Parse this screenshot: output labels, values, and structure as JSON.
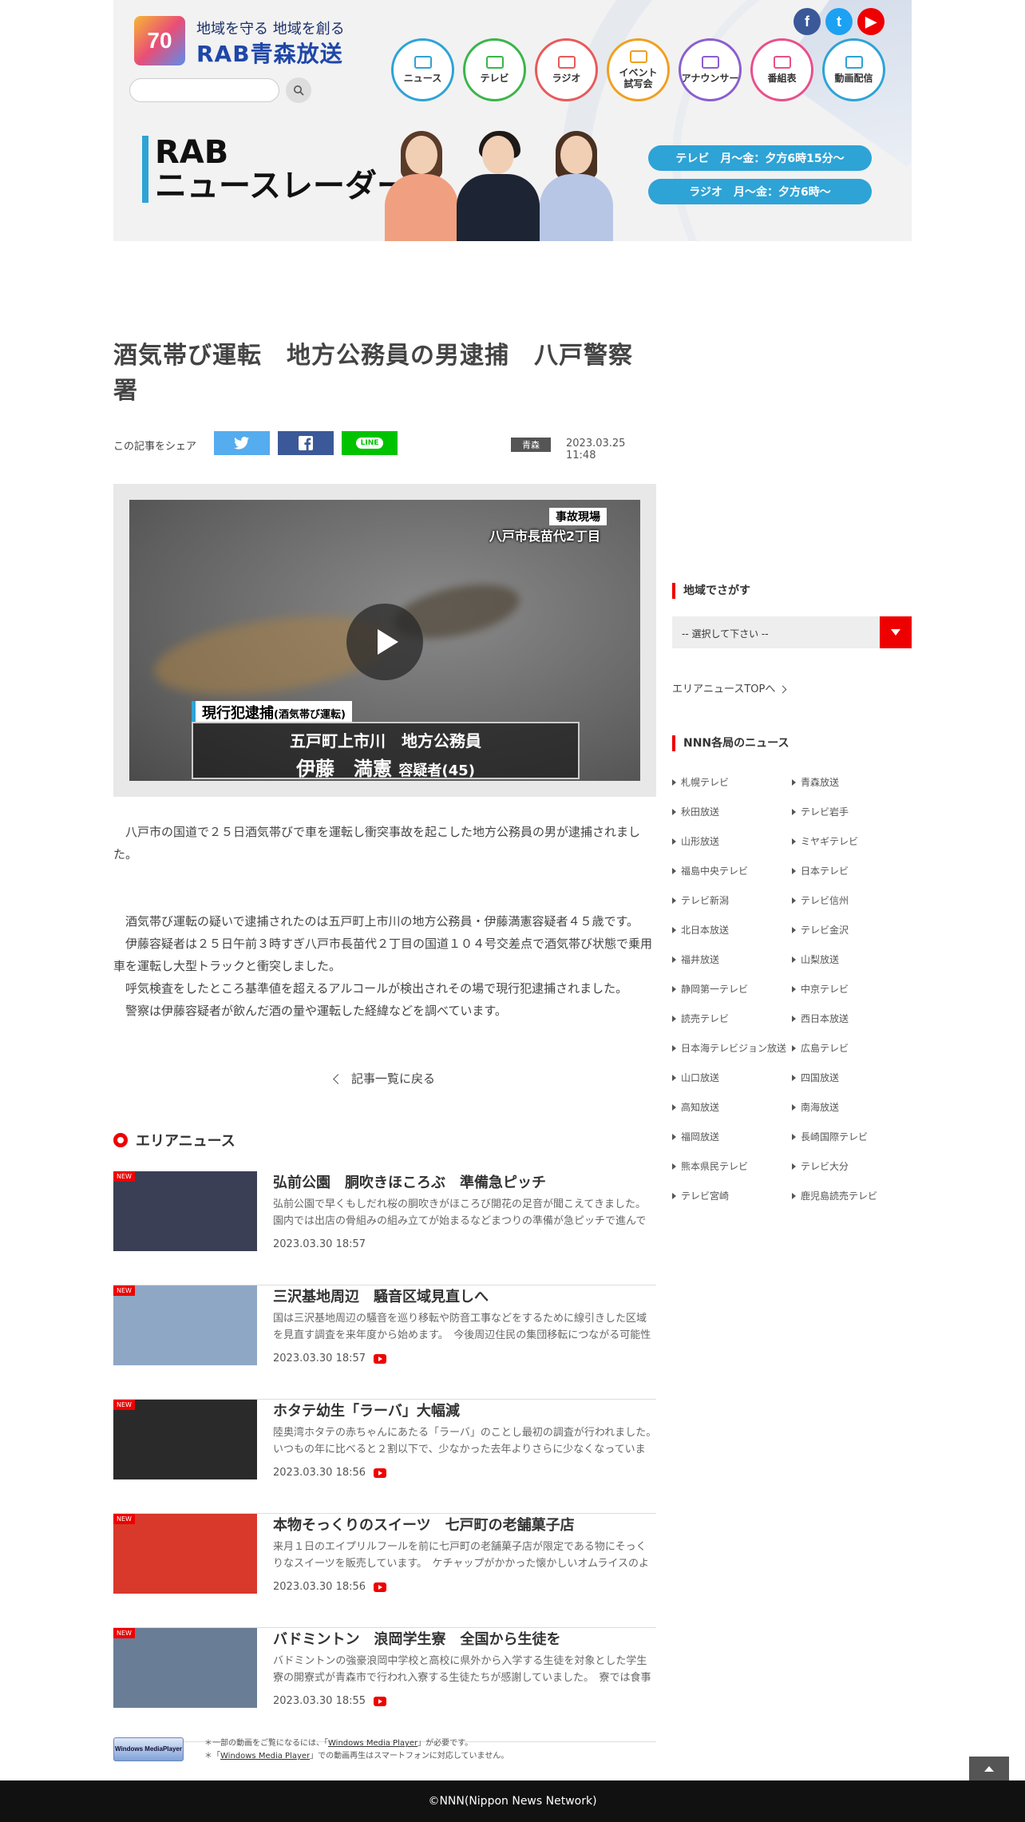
{
  "header": {
    "logo_70": "70",
    "slogan": "地域を守る 地域を創る",
    "station_name": "RAB青森放送",
    "search_placeholder": "",
    "sns": {
      "facebook": "f",
      "twitter": "t",
      "youtube": "▶"
    },
    "nav": [
      {
        "label": "ニュース",
        "color": "#2ea3d6"
      },
      {
        "label": "テレビ",
        "color": "#3bb54a"
      },
      {
        "label": "ラジオ",
        "color": "#e85a5a"
      },
      {
        "label": "イベント\n試写会",
        "color": "#f0a020"
      },
      {
        "label": "アナウンサー",
        "color": "#8a5fd0"
      },
      {
        "label": "番組表",
        "color": "#e8508a"
      },
      {
        "label": "動画配信",
        "color": "#2ea3d6"
      }
    ],
    "banner": {
      "title_line1": "RAB",
      "title_line2": "ニュースレーダー",
      "tv_time": "テレビ　月～金：夕方6時15分～",
      "radio_time": "ラジオ　月～金：夕方6時～"
    }
  },
  "article": {
    "title": "酒気帯び運転　地方公務員の男逮捕　八戸警察署",
    "share_label": "この記事をシェア",
    "share_line": "LINE",
    "category": "青森",
    "date": "2023.03.25 11:48",
    "video": {
      "scene_tag": "事故現場",
      "place": "八戸市長苗代2丁目",
      "arrest_tag": "現行犯逮捕",
      "arrest_sub": "(酒気帯び運転)",
      "suspect_line1": "五戸町上市川　地方公務員",
      "suspect_name": "伊藤　満憲",
      "suspect_suffix": "容疑者(45)"
    },
    "lead": "八戸市の国道で２５日酒気帯びで車を運転し衝突事故を起こした地方公務員の男が逮捕されました。",
    "paragraphs": [
      "酒気帯び運転の疑いで逮捕されたのは五戸町上市川の地方公務員・伊藤満憲容疑者４５歳です。",
      "伊藤容疑者は２５日午前３時すぎ八戸市長苗代２丁目の国道１０４号交差点で酒気帯び状態で乗用車を運転し大型トラックと衝突しました。",
      "呼気検査をしたところ基準値を超えるアルコールが検出されその場で現行犯逮捕されました。",
      "警察は伊藤容疑者が飲んだ酒の量や運転した経緯などを調べています。"
    ],
    "back_label": "記事一覧に戻る"
  },
  "area_news": {
    "heading": "エリアニュース",
    "new_label": "NEW",
    "items": [
      {
        "title": "弘前公園　胴吹きほころぶ　準備急ピッチ",
        "desc": "弘前公園で早くもしだれ桜の胴吹きがほころび開花の足音が聞こえてきました。　園内では出店の骨組みの組み立てが始まるなどまつりの準備が急ピッチで進んでいます。",
        "date": "2023.03.30 18:57",
        "video": false,
        "thumb": "#3a3f55"
      },
      {
        "title": "三沢基地周辺　騒音区域見直しへ",
        "desc": "国は三沢基地周辺の騒音を巡り移転や防音工事などをするために線引きした区域を見直す調査を来年度から始めます。　今後周辺住民の集団移転につながる可能性があります。",
        "date": "2023.03.30 18:57",
        "video": true,
        "thumb": "#8ea7c4"
      },
      {
        "title": "ホタテ幼生「ラーバ」大幅減",
        "desc": "陸奥湾ホタテの赤ちゃんにあたる「ラーバ」のことし最初の調査が行われました。　いつもの年に比べると２割以下で、少なかった去年よりさらに少なくなっています。",
        "date": "2023.03.30 18:56",
        "video": true,
        "thumb": "#2a2a2a"
      },
      {
        "title": "本物そっくりのスイーツ　七戸町の老舗菓子店",
        "desc": "来月１日のエイプリルフールを前に七戸町の老舗菓子店が限定である物にそっくりなスイーツを販売しています。　ケチャップがかかった懐かしいオムライスのような見た目です。",
        "date": "2023.03.30 18:56",
        "video": true,
        "thumb": "#d8392b"
      },
      {
        "title": "バドミントン　浪岡学生寮　全国から生徒を",
        "desc": "バドミントンの強豪浪岡中学校と高校に県外から入学する生徒を対象とした学生寮の開寮式が青森市で行われ入寮する生徒たちが感謝していました。　寮では食事も提供されます。",
        "date": "2023.03.30 18:55",
        "video": true,
        "thumb": "#6a7d96"
      }
    ]
  },
  "sidebar": {
    "region_heading": "地域でさがす",
    "select_value": "-- 選択して下さい --",
    "area_top": "エリアニュースTOPへ",
    "nnn_heading": "NNN各局のニュース",
    "nnn": [
      "札幌テレビ",
      "青森放送",
      "秋田放送",
      "テレビ岩手",
      "山形放送",
      "ミヤギテレビ",
      "福島中央テレビ",
      "日本テレビ",
      "テレビ新潟",
      "テレビ信州",
      "北日本放送",
      "テレビ金沢",
      "福井放送",
      "山梨放送",
      "静岡第一テレビ",
      "中京テレビ",
      "読売テレビ",
      "西日本放送",
      "日本海テレビジョン放送",
      "広島テレビ",
      "山口放送",
      "四国放送",
      "高知放送",
      "南海放送",
      "福岡放送",
      "長崎国際テレビ",
      "熊本県民テレビ",
      "テレビ大分",
      "テレビ宮崎",
      "鹿児島読売テレビ"
    ]
  },
  "footer": {
    "wmp_logo": "Windows MediaPlayer",
    "note1_pre": "＊一部の動画をご覧になるには、「",
    "note1_link": "Windows Media Player",
    "note1_post": "」が必要です。",
    "note2_pre": "＊「",
    "note2_link": "Windows Media Player",
    "note2_post": "」での動画再生はスマートフォンに対応していません。",
    "copyright": "©NNN(Nippon News Network)"
  }
}
